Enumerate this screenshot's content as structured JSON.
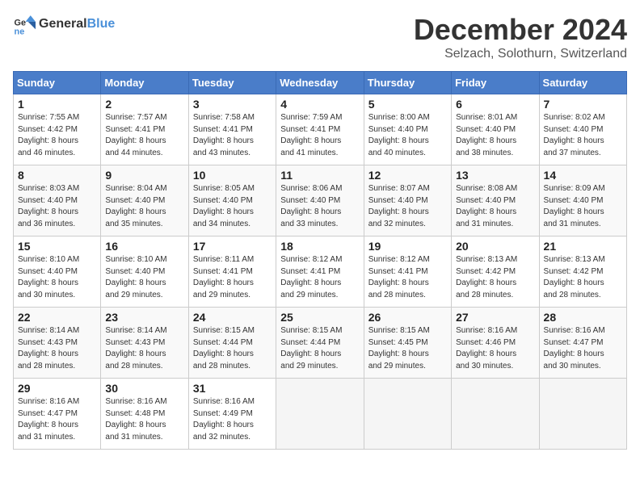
{
  "header": {
    "logo_general": "General",
    "logo_blue": "Blue",
    "month": "December 2024",
    "location": "Selzach, Solothurn, Switzerland"
  },
  "days_of_week": [
    "Sunday",
    "Monday",
    "Tuesday",
    "Wednesday",
    "Thursday",
    "Friday",
    "Saturday"
  ],
  "weeks": [
    [
      {
        "day": "1",
        "lines": [
          "Sunrise: 7:55 AM",
          "Sunset: 4:42 PM",
          "Daylight: 8 hours",
          "and 46 minutes."
        ]
      },
      {
        "day": "2",
        "lines": [
          "Sunrise: 7:57 AM",
          "Sunset: 4:41 PM",
          "Daylight: 8 hours",
          "and 44 minutes."
        ]
      },
      {
        "day": "3",
        "lines": [
          "Sunrise: 7:58 AM",
          "Sunset: 4:41 PM",
          "Daylight: 8 hours",
          "and 43 minutes."
        ]
      },
      {
        "day": "4",
        "lines": [
          "Sunrise: 7:59 AM",
          "Sunset: 4:41 PM",
          "Daylight: 8 hours",
          "and 41 minutes."
        ]
      },
      {
        "day": "5",
        "lines": [
          "Sunrise: 8:00 AM",
          "Sunset: 4:40 PM",
          "Daylight: 8 hours",
          "and 40 minutes."
        ]
      },
      {
        "day": "6",
        "lines": [
          "Sunrise: 8:01 AM",
          "Sunset: 4:40 PM",
          "Daylight: 8 hours",
          "and 38 minutes."
        ]
      },
      {
        "day": "7",
        "lines": [
          "Sunrise: 8:02 AM",
          "Sunset: 4:40 PM",
          "Daylight: 8 hours",
          "and 37 minutes."
        ]
      }
    ],
    [
      {
        "day": "8",
        "lines": [
          "Sunrise: 8:03 AM",
          "Sunset: 4:40 PM",
          "Daylight: 8 hours",
          "and 36 minutes."
        ]
      },
      {
        "day": "9",
        "lines": [
          "Sunrise: 8:04 AM",
          "Sunset: 4:40 PM",
          "Daylight: 8 hours",
          "and 35 minutes."
        ]
      },
      {
        "day": "10",
        "lines": [
          "Sunrise: 8:05 AM",
          "Sunset: 4:40 PM",
          "Daylight: 8 hours",
          "and 34 minutes."
        ]
      },
      {
        "day": "11",
        "lines": [
          "Sunrise: 8:06 AM",
          "Sunset: 4:40 PM",
          "Daylight: 8 hours",
          "and 33 minutes."
        ]
      },
      {
        "day": "12",
        "lines": [
          "Sunrise: 8:07 AM",
          "Sunset: 4:40 PM",
          "Daylight: 8 hours",
          "and 32 minutes."
        ]
      },
      {
        "day": "13",
        "lines": [
          "Sunrise: 8:08 AM",
          "Sunset: 4:40 PM",
          "Daylight: 8 hours",
          "and 31 minutes."
        ]
      },
      {
        "day": "14",
        "lines": [
          "Sunrise: 8:09 AM",
          "Sunset: 4:40 PM",
          "Daylight: 8 hours",
          "and 31 minutes."
        ]
      }
    ],
    [
      {
        "day": "15",
        "lines": [
          "Sunrise: 8:10 AM",
          "Sunset: 4:40 PM",
          "Daylight: 8 hours",
          "and 30 minutes."
        ]
      },
      {
        "day": "16",
        "lines": [
          "Sunrise: 8:10 AM",
          "Sunset: 4:40 PM",
          "Daylight: 8 hours",
          "and 29 minutes."
        ]
      },
      {
        "day": "17",
        "lines": [
          "Sunrise: 8:11 AM",
          "Sunset: 4:41 PM",
          "Daylight: 8 hours",
          "and 29 minutes."
        ]
      },
      {
        "day": "18",
        "lines": [
          "Sunrise: 8:12 AM",
          "Sunset: 4:41 PM",
          "Daylight: 8 hours",
          "and 29 minutes."
        ]
      },
      {
        "day": "19",
        "lines": [
          "Sunrise: 8:12 AM",
          "Sunset: 4:41 PM",
          "Daylight: 8 hours",
          "and 28 minutes."
        ]
      },
      {
        "day": "20",
        "lines": [
          "Sunrise: 8:13 AM",
          "Sunset: 4:42 PM",
          "Daylight: 8 hours",
          "and 28 minutes."
        ]
      },
      {
        "day": "21",
        "lines": [
          "Sunrise: 8:13 AM",
          "Sunset: 4:42 PM",
          "Daylight: 8 hours",
          "and 28 minutes."
        ]
      }
    ],
    [
      {
        "day": "22",
        "lines": [
          "Sunrise: 8:14 AM",
          "Sunset: 4:43 PM",
          "Daylight: 8 hours",
          "and 28 minutes."
        ]
      },
      {
        "day": "23",
        "lines": [
          "Sunrise: 8:14 AM",
          "Sunset: 4:43 PM",
          "Daylight: 8 hours",
          "and 28 minutes."
        ]
      },
      {
        "day": "24",
        "lines": [
          "Sunrise: 8:15 AM",
          "Sunset: 4:44 PM",
          "Daylight: 8 hours",
          "and 28 minutes."
        ]
      },
      {
        "day": "25",
        "lines": [
          "Sunrise: 8:15 AM",
          "Sunset: 4:44 PM",
          "Daylight: 8 hours",
          "and 29 minutes."
        ]
      },
      {
        "day": "26",
        "lines": [
          "Sunrise: 8:15 AM",
          "Sunset: 4:45 PM",
          "Daylight: 8 hours",
          "and 29 minutes."
        ]
      },
      {
        "day": "27",
        "lines": [
          "Sunrise: 8:16 AM",
          "Sunset: 4:46 PM",
          "Daylight: 8 hours",
          "and 30 minutes."
        ]
      },
      {
        "day": "28",
        "lines": [
          "Sunrise: 8:16 AM",
          "Sunset: 4:47 PM",
          "Daylight: 8 hours",
          "and 30 minutes."
        ]
      }
    ],
    [
      {
        "day": "29",
        "lines": [
          "Sunrise: 8:16 AM",
          "Sunset: 4:47 PM",
          "Daylight: 8 hours",
          "and 31 minutes."
        ]
      },
      {
        "day": "30",
        "lines": [
          "Sunrise: 8:16 AM",
          "Sunset: 4:48 PM",
          "Daylight: 8 hours",
          "and 31 minutes."
        ]
      },
      {
        "day": "31",
        "lines": [
          "Sunrise: 8:16 AM",
          "Sunset: 4:49 PM",
          "Daylight: 8 hours",
          "and 32 minutes."
        ]
      },
      null,
      null,
      null,
      null
    ]
  ]
}
